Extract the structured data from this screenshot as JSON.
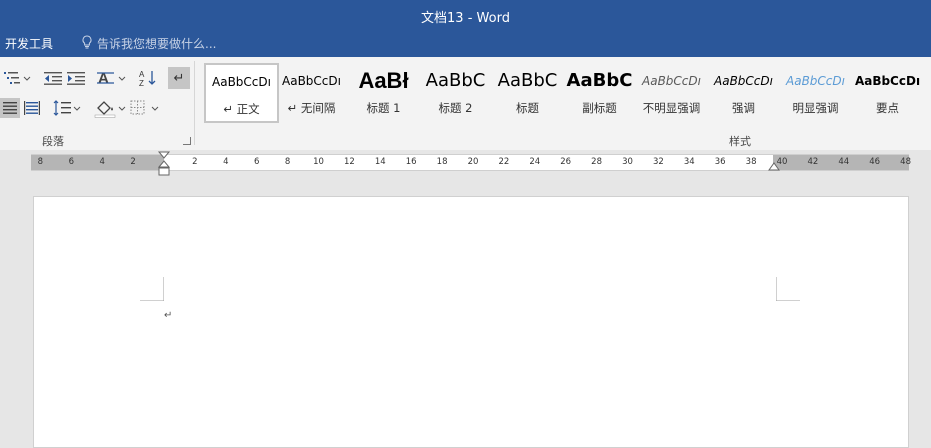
{
  "window": {
    "title": "文档13 - Word"
  },
  "tabs": {
    "developer": "开发工具"
  },
  "tell_me": {
    "placeholder": "告诉我您想要做什么..."
  },
  "paragraph_group": {
    "label": "段落"
  },
  "styles_group": {
    "label": "样式",
    "items": [
      {
        "preview": "AaBbCcDı",
        "name": "↵ 正文",
        "selected": true
      },
      {
        "preview": "AaBbCcDı",
        "name": "↵ 无间隔",
        "selected": false
      },
      {
        "preview": "AaBł",
        "name": "标题 1",
        "selected": false
      },
      {
        "preview": "AaBbC",
        "name": "标题 2",
        "selected": false
      },
      {
        "preview": "AaBbC",
        "name": "标题",
        "selected": false
      },
      {
        "preview": "AaBbC",
        "name": "副标题",
        "selected": false
      },
      {
        "preview": "AaBbCcDı",
        "name": "不明显强调",
        "selected": false
      },
      {
        "preview": "AaBbCcDı",
        "name": "强调",
        "selected": false
      },
      {
        "preview": "AaBbCcDı",
        "name": "明显强调",
        "selected": false
      },
      {
        "preview": "AaBbCcDı",
        "name": "要点",
        "selected": false
      }
    ]
  },
  "ruler": {
    "left_labels": [
      "8",
      "6",
      "4",
      "2"
    ],
    "right_labels": [
      "2",
      "4",
      "6",
      "8",
      "10",
      "12",
      "14",
      "16",
      "18",
      "20",
      "22",
      "24",
      "26",
      "28",
      "30",
      "32",
      "34",
      "36",
      "38",
      "40",
      "42",
      "44",
      "46",
      "48"
    ]
  },
  "document": {
    "paragraph_mark": "↵"
  },
  "colors": {
    "title_bar": "#2b579a",
    "ribbon": "#f3f3f3",
    "workspace": "#e6e6e6"
  }
}
